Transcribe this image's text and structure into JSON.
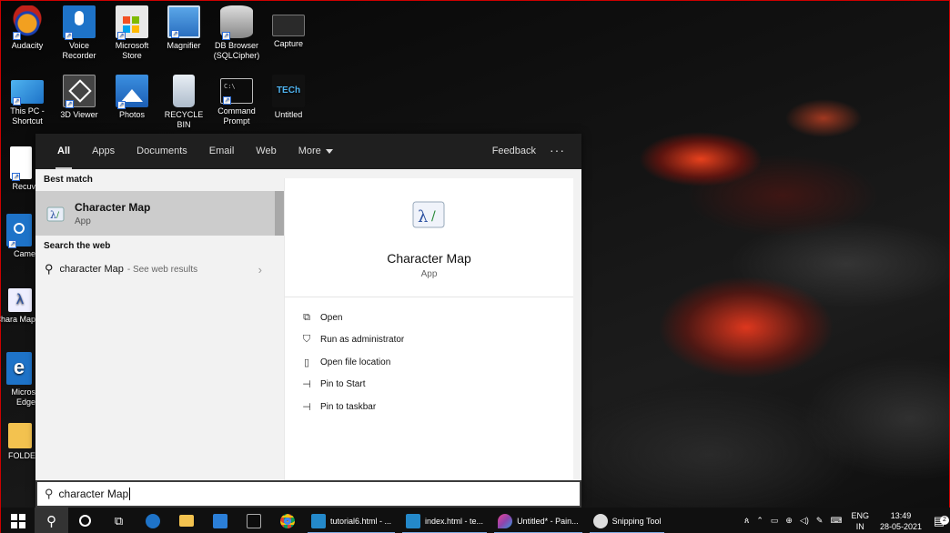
{
  "desktop_icons": [
    {
      "label": "Audacity"
    },
    {
      "label": "Voice Recorder"
    },
    {
      "label": "Microsoft Store"
    },
    {
      "label": "Magnifier"
    },
    {
      "label": "DB Browser (SQLCipher)"
    },
    {
      "label": "Capture"
    },
    {
      "label": "This PC - Shortcut"
    },
    {
      "label": "3D Viewer"
    },
    {
      "label": "Photos"
    },
    {
      "label": "RECYCLE BIN"
    },
    {
      "label": "Command Prompt"
    },
    {
      "label": "Untitled"
    },
    {
      "label": "Recuv"
    },
    {
      "label": "Came"
    },
    {
      "label": "Chara Map"
    },
    {
      "label": "Micros Edge"
    },
    {
      "label": "FOLDE"
    }
  ],
  "untitled_icon_text": "TECh",
  "start": {
    "tabs": [
      {
        "label": "All"
      },
      {
        "label": "Apps"
      },
      {
        "label": "Documents"
      },
      {
        "label": "Email"
      },
      {
        "label": "Web"
      },
      {
        "label": "More"
      }
    ],
    "feedback": "Feedback",
    "more_options": "···",
    "best_match_header": "Best match",
    "best_match": {
      "name": "Character Map",
      "type": "App"
    },
    "web_header": "Search the web",
    "web_result": {
      "query": "character Map",
      "suffix": "- See web results"
    },
    "detail": {
      "name": "Character Map",
      "type": "App"
    },
    "actions": [
      {
        "label": "Open",
        "icon": "open-icon"
      },
      {
        "label": "Run as administrator",
        "icon": "admin-icon"
      },
      {
        "label": "Open file location",
        "icon": "file-location-icon"
      },
      {
        "label": "Pin to Start",
        "icon": "pin-icon"
      },
      {
        "label": "Pin to taskbar",
        "icon": "pin-icon"
      }
    ]
  },
  "search": {
    "value": "character Map"
  },
  "taskbar": {
    "apps": [
      {
        "label": "tutorial6.html - ..."
      },
      {
        "label": "index.html - te..."
      },
      {
        "label": "Untitled* - Pain..."
      },
      {
        "label": "Snipping Tool"
      }
    ],
    "lang_top": "ENG",
    "lang_bottom": "IN",
    "time": "13:49",
    "date": "28-05-2021",
    "notification_count": "2"
  },
  "colors": {
    "accent": "#0078d7",
    "taskbar": "#101010",
    "selected_row": "#cccccc"
  }
}
